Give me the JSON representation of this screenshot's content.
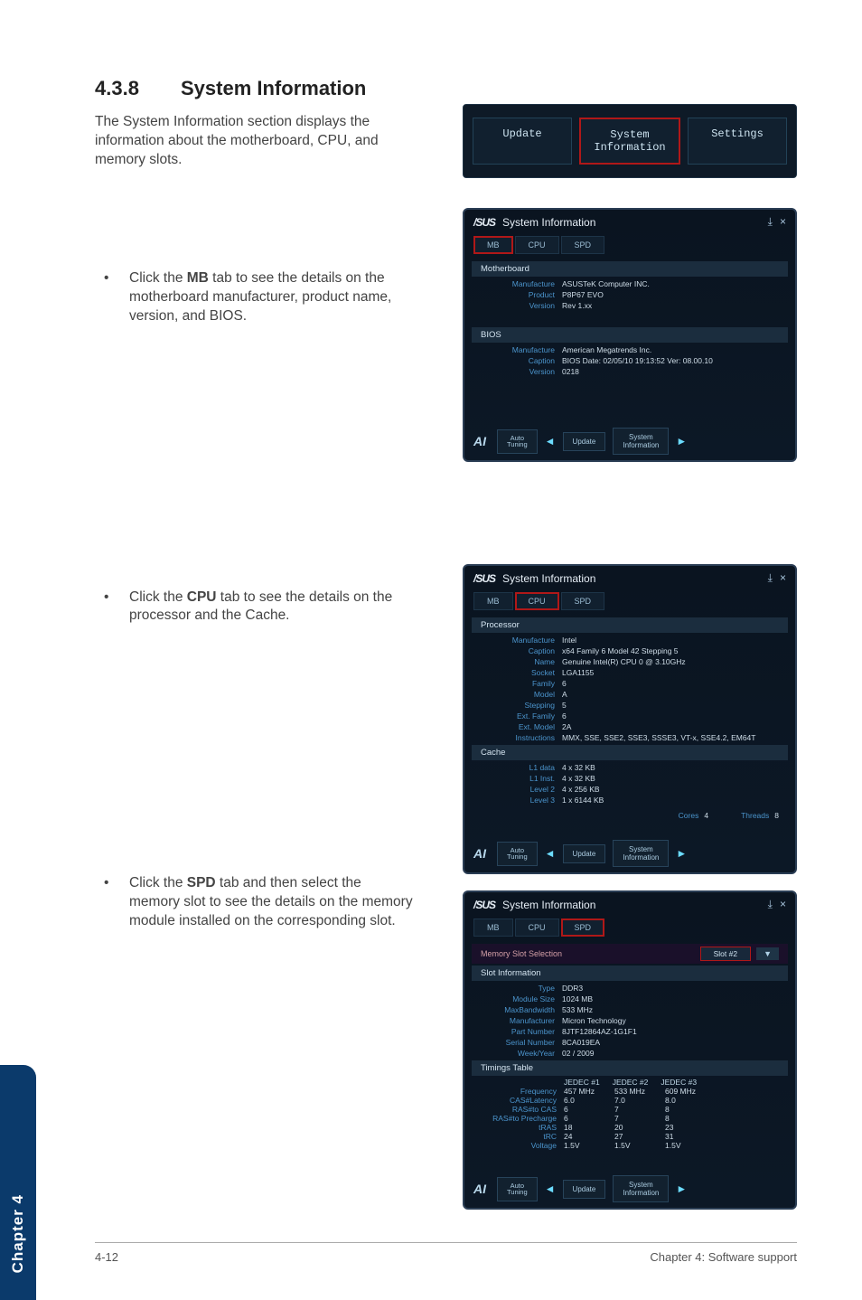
{
  "heading": {
    "number": "4.3.8",
    "title": "System Information"
  },
  "intro": "The System Information section displays the information about the motherboard, CPU, and memory slots.",
  "topTabs": {
    "update": "Update",
    "sysinfo": "System\nInformation",
    "settings": "Settings"
  },
  "bullets": {
    "mb": "Click the MB tab to see the details on the motherboard manufacturer, product name, version, and BIOS.",
    "cpu": "Click the CPU tab to see the details on the processor and the Cache.",
    "spd": "Click the SPD tab and then select the memory slot to see the details on the memory module installed on the corresponding slot."
  },
  "common": {
    "logo": "/SUS",
    "title": "System Information",
    "navAuto": "Auto\nTuning",
    "navUpdate": "Update",
    "navSys": "System\nInformation",
    "pin": "⤓",
    "close": "×"
  },
  "mb": {
    "tabs": {
      "mb": "MB",
      "cpu": "CPU",
      "spd": "SPD"
    },
    "sec1": "Motherboard",
    "mb_rows": [
      {
        "k": "Manufacture",
        "v": "ASUSTeK Computer INC."
      },
      {
        "k": "Product",
        "v": "P8P67 EVO"
      },
      {
        "k": "Version",
        "v": "Rev 1.xx"
      }
    ],
    "sec2": "BIOS",
    "bios_rows": [
      {
        "k": "Manufacture",
        "v": "American Megatrends Inc."
      },
      {
        "k": "Caption",
        "v": "BIOS Date: 02/05/10 19:13:52 Ver: 08.00.10"
      },
      {
        "k": "Version",
        "v": "0218"
      }
    ]
  },
  "cpu": {
    "tabs": {
      "mb": "MB",
      "cpu": "CPU",
      "spd": "SPD"
    },
    "sec1": "Processor",
    "proc_rows": [
      {
        "k": "Manufacture",
        "v": "Intel"
      },
      {
        "k": "Caption",
        "v": "x64 Family 6 Model 42 Stepping 5"
      },
      {
        "k": "Name",
        "v": "Genuine Intel(R) CPU 0 @ 3.10GHz"
      },
      {
        "k": "Socket",
        "v": "LGA1155"
      },
      {
        "k": "Family",
        "v": "6"
      },
      {
        "k": "Model",
        "v": "A"
      },
      {
        "k": "Stepping",
        "v": "5"
      },
      {
        "k": "Ext. Family",
        "v": "6"
      },
      {
        "k": "Ext. Model",
        "v": "2A"
      },
      {
        "k": "Instructions",
        "v": "MMX, SSE, SSE2, SSE3, SSSE3, VT-x, SSE4.2, EM64T"
      }
    ],
    "sec2": "Cache",
    "cache_rows": [
      {
        "k": "L1 data",
        "v": "4 x 32 KB"
      },
      {
        "k": "L1 Inst.",
        "v": "4 x 32 KB"
      },
      {
        "k": "Level 2",
        "v": "4 x 256 KB"
      },
      {
        "k": "Level 3",
        "v": "1 x 6144 KB"
      }
    ],
    "cores_l": "Cores",
    "cores_v": "4",
    "threads_l": "Threads",
    "threads_v": "8"
  },
  "spd": {
    "tabs": {
      "mb": "MB",
      "cpu": "CPU",
      "spd": "SPD"
    },
    "memsel_l": "Memory Slot Selection",
    "memsel_v": "Slot #2",
    "caret": "▼",
    "sec1": "Slot Information",
    "info_rows": [
      {
        "k": "Type",
        "v": "DDR3"
      },
      {
        "k": "Module Size",
        "v": "1024 MB"
      },
      {
        "k": "MaxBandwidth",
        "v": "533 MHz"
      },
      {
        "k": "Manufacturer",
        "v": "Micron Technology"
      },
      {
        "k": "Part Number",
        "v": "8JTF12864AZ-1G1F1"
      },
      {
        "k": "Serial Number",
        "v": "8CA019EA"
      },
      {
        "k": "Week/Year",
        "v": "02 / 2009"
      }
    ],
    "sec2": "Timings Table",
    "tim_hdr": [
      "JEDEC #1",
      "JEDEC #2",
      "JEDEC #3"
    ],
    "tim_rows": [
      {
        "k": "Frequency",
        "c": [
          "457 MHz",
          "533 MHz",
          "609 MHz"
        ]
      },
      {
        "k": "CAS#Latency",
        "c": [
          "6.0",
          "7.0",
          "8.0"
        ]
      },
      {
        "k": "RAS#to CAS",
        "c": [
          "6",
          "7",
          "8"
        ]
      },
      {
        "k": "RAS#to Precharge",
        "c": [
          "6",
          "7",
          "8"
        ]
      },
      {
        "k": "tRAS",
        "c": [
          "18",
          "20",
          "23"
        ]
      },
      {
        "k": "tRC",
        "c": [
          "24",
          "27",
          "31"
        ]
      },
      {
        "k": "Voltage",
        "c": [
          "1.5V",
          "1.5V",
          "1.5V"
        ]
      }
    ]
  },
  "sidebar": "Chapter 4",
  "footer": {
    "left": "4-12",
    "right": "Chapter 4: Software support"
  }
}
